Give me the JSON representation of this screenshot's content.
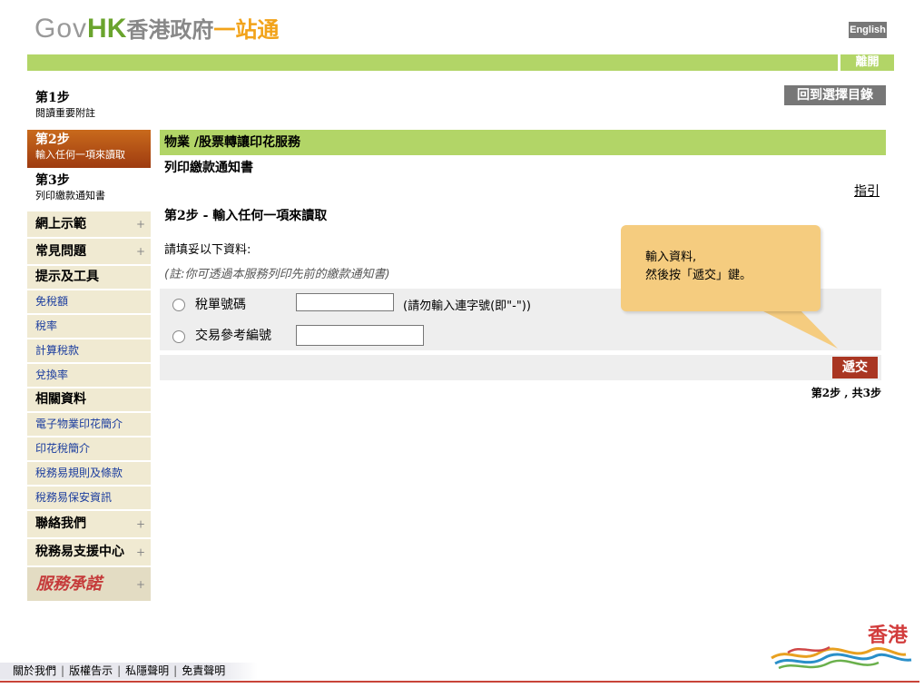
{
  "header": {
    "logo_gov": "Gov",
    "logo_hk": "HK",
    "logo_cn": "香港政府",
    "logo_cn2": "一站通",
    "language_button": "English",
    "exit_button": "離開"
  },
  "steps": [
    {
      "title": "第1步",
      "desc": "閱讀重要附註"
    },
    {
      "title": "第2步",
      "desc": "輸入任何一項來讀取"
    },
    {
      "title": "第3步",
      "desc": "列印繳款通知書"
    }
  ],
  "nav": {
    "demo": "網上示範",
    "faq": "常見問題",
    "tips_tools": "提示及工具",
    "tips_items": [
      "免稅額",
      "稅率",
      "計算稅款",
      "兌換率"
    ],
    "related": "相關資料",
    "related_items": [
      "電子物業印花簡介",
      "印花稅簡介",
      "稅務易規則及條款",
      "稅務易保安資訊"
    ],
    "contact": "聯絡我們",
    "support": "稅務易支援中心",
    "promise": "服務承諾",
    "plus_symbol": "+"
  },
  "main": {
    "back_button": "回到選擇目錄",
    "service_title": "物業 /股票轉讓印花服務",
    "subtitle": "列印繳款通知書",
    "guide_link": "指引",
    "step_title": "第2步  - 輸入任何一項來讀取",
    "instruction": "請填妥以下資料:",
    "note": "(註:你可透過本服務列印先前的繳款通知書)",
    "fields": [
      {
        "label": "稅單號碼",
        "value": "",
        "hint": "(請勿輸入連字號(即\"-\"))"
      },
      {
        "label": "交易參考編號",
        "value": "",
        "hint": ""
      }
    ],
    "submit_button": "遞交",
    "progress": "第2步 , 共3步"
  },
  "tooltip": {
    "line1": "輸入資料,",
    "line2": "然後按「遞交」鍵。"
  },
  "footer": {
    "links": [
      "關於我們",
      "版權告示",
      "私隱聲明",
      "免責聲明"
    ],
    "brand_text": "香港"
  }
}
